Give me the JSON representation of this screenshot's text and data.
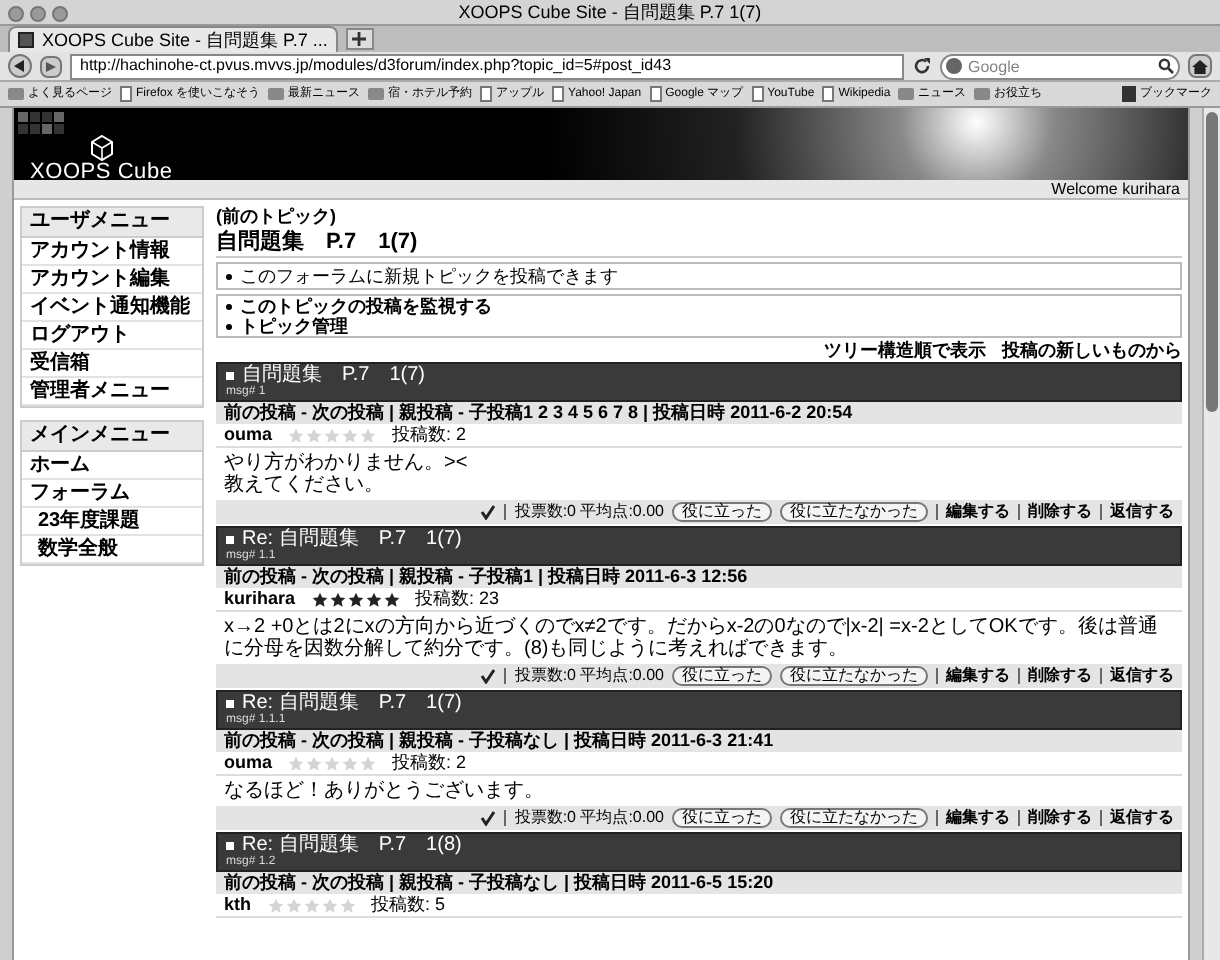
{
  "browser": {
    "window_title": "XOOPS Cube Site - 自問題集 P.7 1(7)",
    "tabs": [
      {
        "label": "XOOPS Cube Site - 自問題集 P.7 ...",
        "selected": true
      }
    ],
    "url": "http://hachinohe-ct.pvus.mvvs.jp/modules/d3forum/index.php?topic_id=5#post_id43",
    "search_placeholder": "Google",
    "bookmarks": [
      {
        "label": "よく見るページ",
        "kind": "folder"
      },
      {
        "label": "Firefox を使いこなそう",
        "kind": "page"
      },
      {
        "label": "最新ニュース",
        "kind": "folder"
      },
      {
        "label": "宿・ホテル予約",
        "kind": "folder"
      },
      {
        "label": "アップル",
        "kind": "page"
      },
      {
        "label": "Yahoo! Japan",
        "kind": "page"
      },
      {
        "label": "Google マップ",
        "kind": "page"
      },
      {
        "label": "YouTube",
        "kind": "page"
      },
      {
        "label": "Wikipedia",
        "kind": "page"
      },
      {
        "label": "ニュース",
        "kind": "folder"
      },
      {
        "label": "お役立ち",
        "kind": "folder"
      }
    ],
    "bookmarks_menu": "ブックマーク"
  },
  "site": {
    "logo": "XOOPS Cube",
    "welcome": "Welcome kurihara"
  },
  "sidebar": [
    {
      "title": "ユーザメニュー",
      "items": [
        {
          "label": "アカウント情報"
        },
        {
          "label": "アカウント編集"
        },
        {
          "label": "イベント通知機能"
        },
        {
          "label": "ログアウト"
        },
        {
          "label": "受信箱"
        },
        {
          "label": "管理者メニュー"
        }
      ]
    },
    {
      "title": "メインメニュー",
      "items": [
        {
          "label": "ホーム"
        },
        {
          "label": "フォーラム",
          "children": [
            {
              "label": "23年度課題"
            },
            {
              "label": "数学全般"
            }
          ]
        }
      ]
    }
  ],
  "main": {
    "prev_topic": "(前のトピック)",
    "heading": "自問題集　P.7　1(7)",
    "notice": "このフォーラムに新規トピックを投稿できます",
    "actions": [
      "このトピックの投稿を監視する",
      "トピック管理"
    ],
    "view_links": [
      "ツリー構造順で表示",
      "投稿の新しいものから"
    ],
    "posts": [
      {
        "title": "自問題集　P.7　1(7)",
        "msg": "msg# 1",
        "nav": "前の投稿 - 次の投稿 | 親投稿 - 子投稿1 2 3 4 5 6 7 8 | 投稿日時 2011-6-2 20:54",
        "user": "ouma",
        "stars": 0,
        "post_count": "投稿数: 2",
        "body": [
          "やり方がわかりません。><",
          "教えてください。"
        ],
        "votes": "投票数:0 平均点:0.00",
        "vote_buttons": [
          "役に立った",
          "役に立たなかった"
        ],
        "links": [
          "編集する",
          "削除する",
          "返信する"
        ]
      },
      {
        "title": "Re: 自問題集　P.7　1(7)",
        "msg": "msg# 1.1",
        "nav": "前の投稿 - 次の投稿 | 親投稿 - 子投稿1 | 投稿日時 2011-6-3 12:56",
        "user": "kurihara",
        "stars": 5,
        "post_count": "投稿数: 23",
        "body": [
          "x→2 +0とは2にxの方向から近づくのでx≠2です。だからx-2の0なので|x-2| =x-2としてOKです。後は普通に分母を因数分解して約分です。(8)も同じように考えればできます。"
        ],
        "votes": "投票数:0 平均点:0.00",
        "vote_buttons": [
          "役に立った",
          "役に立たなかった"
        ],
        "links": [
          "編集する",
          "削除する",
          "返信する"
        ]
      },
      {
        "title": "Re: 自問題集　P.7　1(7)",
        "msg": "msg# 1.1.1",
        "nav": "前の投稿 - 次の投稿 | 親投稿 - 子投稿なし | 投稿日時 2011-6-3 21:41",
        "user": "ouma",
        "stars": 0,
        "post_count": "投稿数: 2",
        "body": [
          "なるほど！ありがとうございます。"
        ],
        "votes": "投票数:0 平均点:0.00",
        "vote_buttons": [
          "役に立った",
          "役に立たなかった"
        ],
        "links": [
          "編集する",
          "削除する",
          "返信する"
        ]
      },
      {
        "title": "Re: 自問題集　P.7　1(8)",
        "msg": "msg# 1.2",
        "nav": "前の投稿 - 次の投稿 | 親投稿 - 子投稿なし | 投稿日時 2011-6-5 15:20",
        "user": "kth",
        "stars": 0,
        "post_count": "投稿数: 5"
      }
    ]
  }
}
